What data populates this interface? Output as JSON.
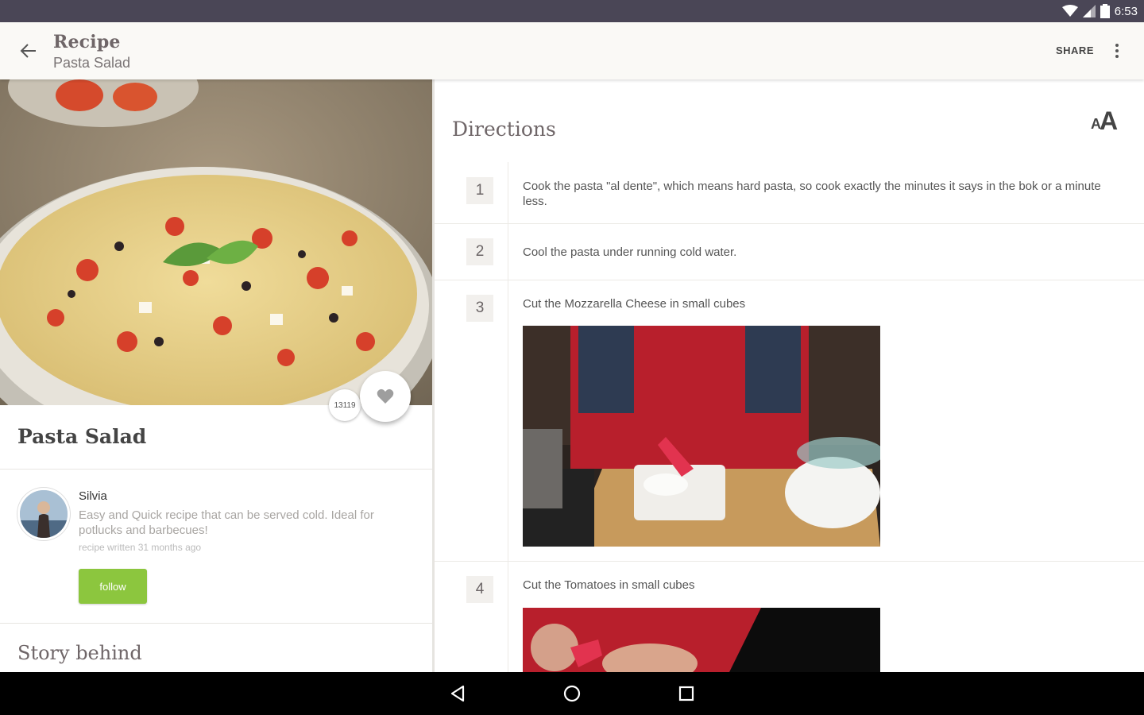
{
  "status_bar": {
    "time": "6:53"
  },
  "app_bar": {
    "title": "Recipe",
    "subtitle": "Pasta Salad",
    "share_label": "SHARE"
  },
  "recipe": {
    "title": "Pasta Salad",
    "likes": "13119",
    "author": {
      "name": "Silvia",
      "description": "Easy and Quick recipe that can be served cold. Ideal for potlucks and barbecues!",
      "written": "recipe written 31 months ago",
      "follow_label": "follow"
    },
    "story_title": "Story behind"
  },
  "directions": {
    "title": "Directions",
    "steps": [
      {
        "number": "1",
        "text": "Cook the pasta \"al dente\", which means hard pasta, so cook exactly the minutes it says in the bok or a minute less."
      },
      {
        "number": "2",
        "text": "Cool the pasta under running cold water."
      },
      {
        "number": "3",
        "text": "Cut the Mozzarella Cheese in small cubes"
      },
      {
        "number": "4",
        "text": "Cut the Tomatoes in small cubes"
      }
    ]
  },
  "colors": {
    "status_bar": "#4a4656",
    "app_bar": "#faf9f6",
    "follow_button": "#8cc63e",
    "nav_bar": "#000000"
  },
  "icons": {
    "back": "arrow-back-icon",
    "overflow": "more-vert-icon",
    "like": "heart-icon",
    "text_size": "text-size-icon",
    "nav_back": "nav-back-icon",
    "nav_home": "nav-home-icon",
    "nav_recents": "nav-recents-icon"
  }
}
